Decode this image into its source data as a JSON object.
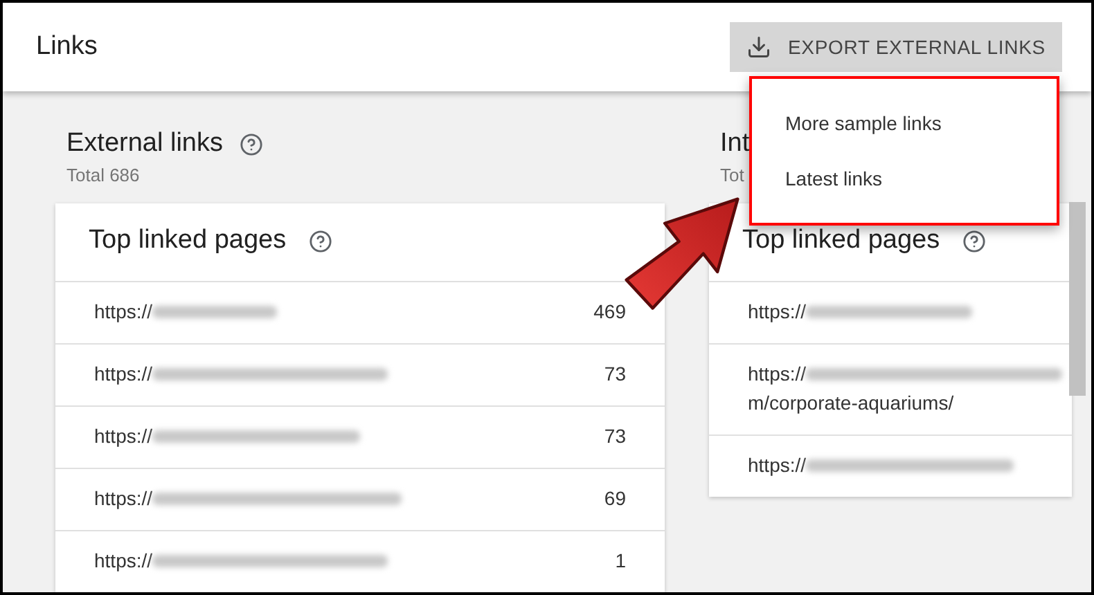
{
  "header": {
    "title": "Links",
    "export_button": "EXPORT EXTERNAL LINKS"
  },
  "menu": {
    "items": [
      "More sample links",
      "Latest links"
    ]
  },
  "panels": [
    {
      "title": "External links",
      "total": "Total 686",
      "card_title": "Top linked pages",
      "rows": [
        {
          "url": "https://",
          "count": "469"
        },
        {
          "url": "https://",
          "count": "73"
        },
        {
          "url": "https://",
          "count": "73"
        },
        {
          "url": "https://",
          "count": "69"
        },
        {
          "url": "https://",
          "count": "1"
        }
      ]
    },
    {
      "title": "Int",
      "total": "Tot",
      "card_title": "Top linked pages",
      "rows": [
        {
          "url": "https://"
        },
        {
          "url": "https://",
          "continuation": "m/corporate-aquariums/"
        },
        {
          "url": "https://"
        }
      ]
    }
  ]
}
